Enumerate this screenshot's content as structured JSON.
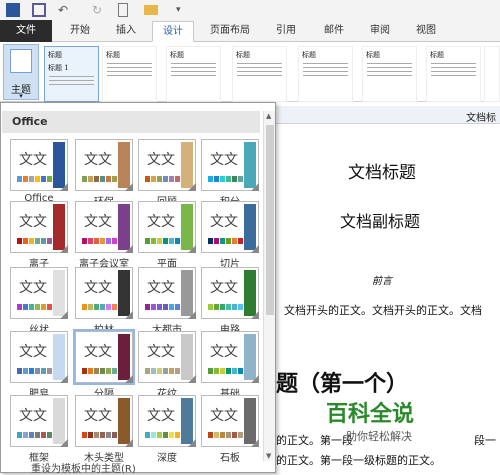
{
  "qat": {
    "icons": [
      "word-icon",
      "save-icon",
      "undo-icon",
      "redo-icon",
      "new-icon",
      "open-icon",
      "customize-icon"
    ]
  },
  "tabs": [
    "文件",
    "开始",
    "插入",
    "设计",
    "页面布局",
    "引用",
    "邮件",
    "审阅",
    "视图"
  ],
  "ribbon": {
    "theme_label": "主题",
    "style_titles": [
      "标题",
      "标题",
      "标题",
      "标题",
      "标题",
      "标题",
      "标题",
      "标题",
      "标题"
    ],
    "style_sub": "标题 1"
  },
  "panel": {
    "header": "Office",
    "reset": "重设为模板中的主题(R)",
    "themes": [
      {
        "name": "Office",
        "band": "#2b579a",
        "c": [
          "#5b9bd5",
          "#ed7d31",
          "#a5a5a5",
          "#ffc000",
          "#4472c4",
          "#70ad47"
        ]
      },
      {
        "name": "环保",
        "band": "#b9845a",
        "c": [
          "#7f9f5b",
          "#c6a05b",
          "#8f6840",
          "#5e8a8a",
          "#c27a48",
          "#a1a04a"
        ]
      },
      {
        "name": "回顾",
        "band": "#d3b27a",
        "c": [
          "#c55a11",
          "#d6a548",
          "#94a15e",
          "#6f8ec0",
          "#a37ea8",
          "#c06b6b"
        ]
      },
      {
        "name": "积分",
        "band": "#4aa8b8",
        "c": [
          "#1cade4",
          "#2683c6",
          "#27ced7",
          "#42ba97",
          "#3e8853",
          "#62a39f"
        ]
      },
      {
        "name": "离子",
        "band": "#a32a2a",
        "c": [
          "#b01513",
          "#ea6312",
          "#e6b729",
          "#6aac90",
          "#5f9c9d",
          "#9e5e9b"
        ]
      },
      {
        "name": "离子会议室",
        "band": "#7b3f8c",
        "c": [
          "#b31166",
          "#e33d6f",
          "#e45f3c",
          "#e9943a",
          "#9b6bf2",
          "#d53dd0"
        ]
      },
      {
        "name": "平面",
        "band": "#7ab648",
        "c": [
          "#549e39",
          "#8ab833",
          "#c0cf3a",
          "#029676",
          "#4ab5c4",
          "#0989b1"
        ]
      },
      {
        "name": "切片",
        "band": "#3b6c9c",
        "c": [
          "#052f61",
          "#a50e82",
          "#14967c",
          "#6a9e1f",
          "#e87d37",
          "#c62324"
        ]
      },
      {
        "name": "丝状",
        "band": "#e0e0e0",
        "c": [
          "#ac3ec1",
          "#477bd1",
          "#46b298",
          "#90ba4c",
          "#dd9d31",
          "#e25247"
        ]
      },
      {
        "name": "柏林",
        "band": "#333333",
        "c": [
          "#f09415",
          "#c1b56b",
          "#4baf73",
          "#5aa6c0",
          "#d17df9",
          "#fa7e5c"
        ]
      },
      {
        "name": "大都市",
        "band": "#999999",
        "c": [
          "#92278f",
          "#9b57d3",
          "#755dd9",
          "#665eb8",
          "#45a5ed",
          "#5982db"
        ]
      },
      {
        "name": "电路",
        "band": "#2e7d32",
        "c": [
          "#99cb38",
          "#63a537",
          "#37a76f",
          "#44c1a3",
          "#4eb3cf",
          "#51c3f9"
        ]
      },
      {
        "name": "肥皂",
        "band": "#c7d9ee",
        "c": [
          "#4a66ac",
          "#629dd1",
          "#297fd5",
          "#7f8fa9",
          "#5aa2ae",
          "#9d90a0"
        ]
      },
      {
        "name": "分隔",
        "band": "#6b1f3a",
        "c": [
          "#a53010",
          "#de7e18",
          "#9f8351",
          "#728653",
          "#92aa4c",
          "#6aac91"
        ]
      },
      {
        "name": "花纹",
        "band": "#c9c9c9",
        "c": [
          "#a9a57c",
          "#9cbebd",
          "#d2cb6c",
          "#95a39d",
          "#c89f5d",
          "#b1a089"
        ]
      },
      {
        "name": "基础",
        "band": "#8fb3c9",
        "c": [
          "#549e39",
          "#8ab833",
          "#c0cf3a",
          "#029676",
          "#4ab5c4",
          "#0989b1"
        ]
      },
      {
        "name": "框架",
        "band": "#d9d9d9",
        "c": [
          "#40a5c4",
          "#8da3c6",
          "#5e83bf",
          "#7a7a7a",
          "#a35a5a",
          "#5a8a6a"
        ]
      },
      {
        "name": "木头类型",
        "band": "#8b5a2b",
        "c": [
          "#d34817",
          "#9b2d1f",
          "#a28e6a",
          "#956251",
          "#918485",
          "#855d5d"
        ]
      },
      {
        "name": "深度",
        "band": "#4f7b9a",
        "c": [
          "#41aebd",
          "#97e9d5",
          "#a2cf49",
          "#608f3d",
          "#f4de3a",
          "#fcb11c"
        ]
      },
      {
        "name": "石板",
        "band": "#6b6b6b",
        "c": [
          "#bc451b",
          "#d3ba68",
          "#bb8640",
          "#ad9277",
          "#a55a43",
          "#ad9d7b"
        ]
      }
    ],
    "tile_text": "文文"
  },
  "doc": {
    "bar_label": "文档标",
    "title": "文档标题",
    "subtitle": "文档副标题",
    "preface": "前言",
    "body1": "文档开头的正文。文档开头的正文。文档",
    "heading": "题（第一个）",
    "body2": "的正文。第一段",
    "body3": "段一",
    "body4": "的正文。第一段一级标题的正文。"
  },
  "watermark": {
    "brand": "百科全说",
    "slogan": "助你轻松解决"
  }
}
